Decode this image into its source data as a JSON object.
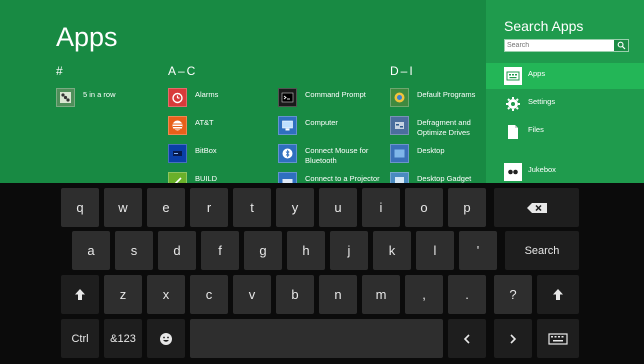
{
  "apps_screen": {
    "title": "Apps",
    "groups": [
      {
        "heading": "#"
      },
      {
        "heading": "A–C"
      },
      {
        "heading": "D–I"
      }
    ],
    "tiles": [
      {
        "label": "5 in a row",
        "icon": "game-icon",
        "color": "#4f8f5a"
      },
      {
        "label": "Alarms",
        "icon": "alarm-clock-icon",
        "color": "#d83a3a"
      },
      {
        "label": "AT&T",
        "icon": "att-logo-icon",
        "color": "#e8601a"
      },
      {
        "label": "BitBox",
        "icon": "bitbox-icon",
        "color": "#0a3fa8"
      },
      {
        "label": "BUILD",
        "icon": "build-icon",
        "color": "#6ab02a"
      },
      {
        "label": "Command Prompt",
        "icon": "command-prompt-icon",
        "color": "#1a1a1a"
      },
      {
        "label": "Computer",
        "icon": "computer-icon",
        "color": "#2f6fbf"
      },
      {
        "label": "Connect Mouse for Bluetooth",
        "icon": "bluetooth-mouse-icon",
        "color": "#2f6fbf"
      },
      {
        "label": "Connect to a Projector",
        "icon": "projector-icon",
        "color": "#2f6fbf"
      },
      {
        "label": "Default Programs",
        "icon": "default-programs-icon",
        "color": "#3f8a3f"
      },
      {
        "label": "Defragment and Optimize Drives",
        "icon": "defragment-icon",
        "color": "#4b6e9e"
      },
      {
        "label": "Desktop",
        "icon": "desktop-icon",
        "color": "#3a70b8"
      },
      {
        "label": "Desktop Gadget",
        "icon": "desktop-gadget-icon",
        "color": "#4a8ac0"
      }
    ]
  },
  "search_pane": {
    "title": "Search Apps",
    "search_value": "",
    "search_placeholder": "Search",
    "items": [
      {
        "label": "Apps",
        "icon": "apps-keyboard-icon",
        "selected": true
      },
      {
        "label": "Settings",
        "icon": "gear-icon",
        "selected": false
      },
      {
        "label": "Files",
        "icon": "file-icon",
        "selected": false
      },
      {
        "label": "Jukebox",
        "icon": "jukebox-icon",
        "selected": false
      }
    ]
  },
  "keyboard": {
    "row1": [
      "q",
      "w",
      "e",
      "r",
      "t",
      "y",
      "u",
      "i",
      "o",
      "p"
    ],
    "backspace_icon": "backspace-icon",
    "row2": [
      "a",
      "s",
      "d",
      "f",
      "g",
      "h",
      "j",
      "k",
      "l",
      "'"
    ],
    "search_label": "Search",
    "shift_icon": "shift-icon",
    "row3": [
      "z",
      "x",
      "c",
      "v",
      "b",
      "n",
      "m",
      ",",
      ".",
      "?"
    ],
    "ctrl_label": "Ctrl",
    "symbols_label": "&123",
    "emoji_icon": "emoji-icon",
    "left_icon": "arrow-left-icon",
    "right_icon": "arrow-right-icon",
    "keyboard_icon": "keyboard-icon"
  },
  "colors": {
    "background_green": "#188a43",
    "pane_green": "#1f9b4d",
    "selected_green": "#23b657",
    "key_face": "#2e2e2e",
    "keyboard_bg": "#0b0b0b"
  }
}
